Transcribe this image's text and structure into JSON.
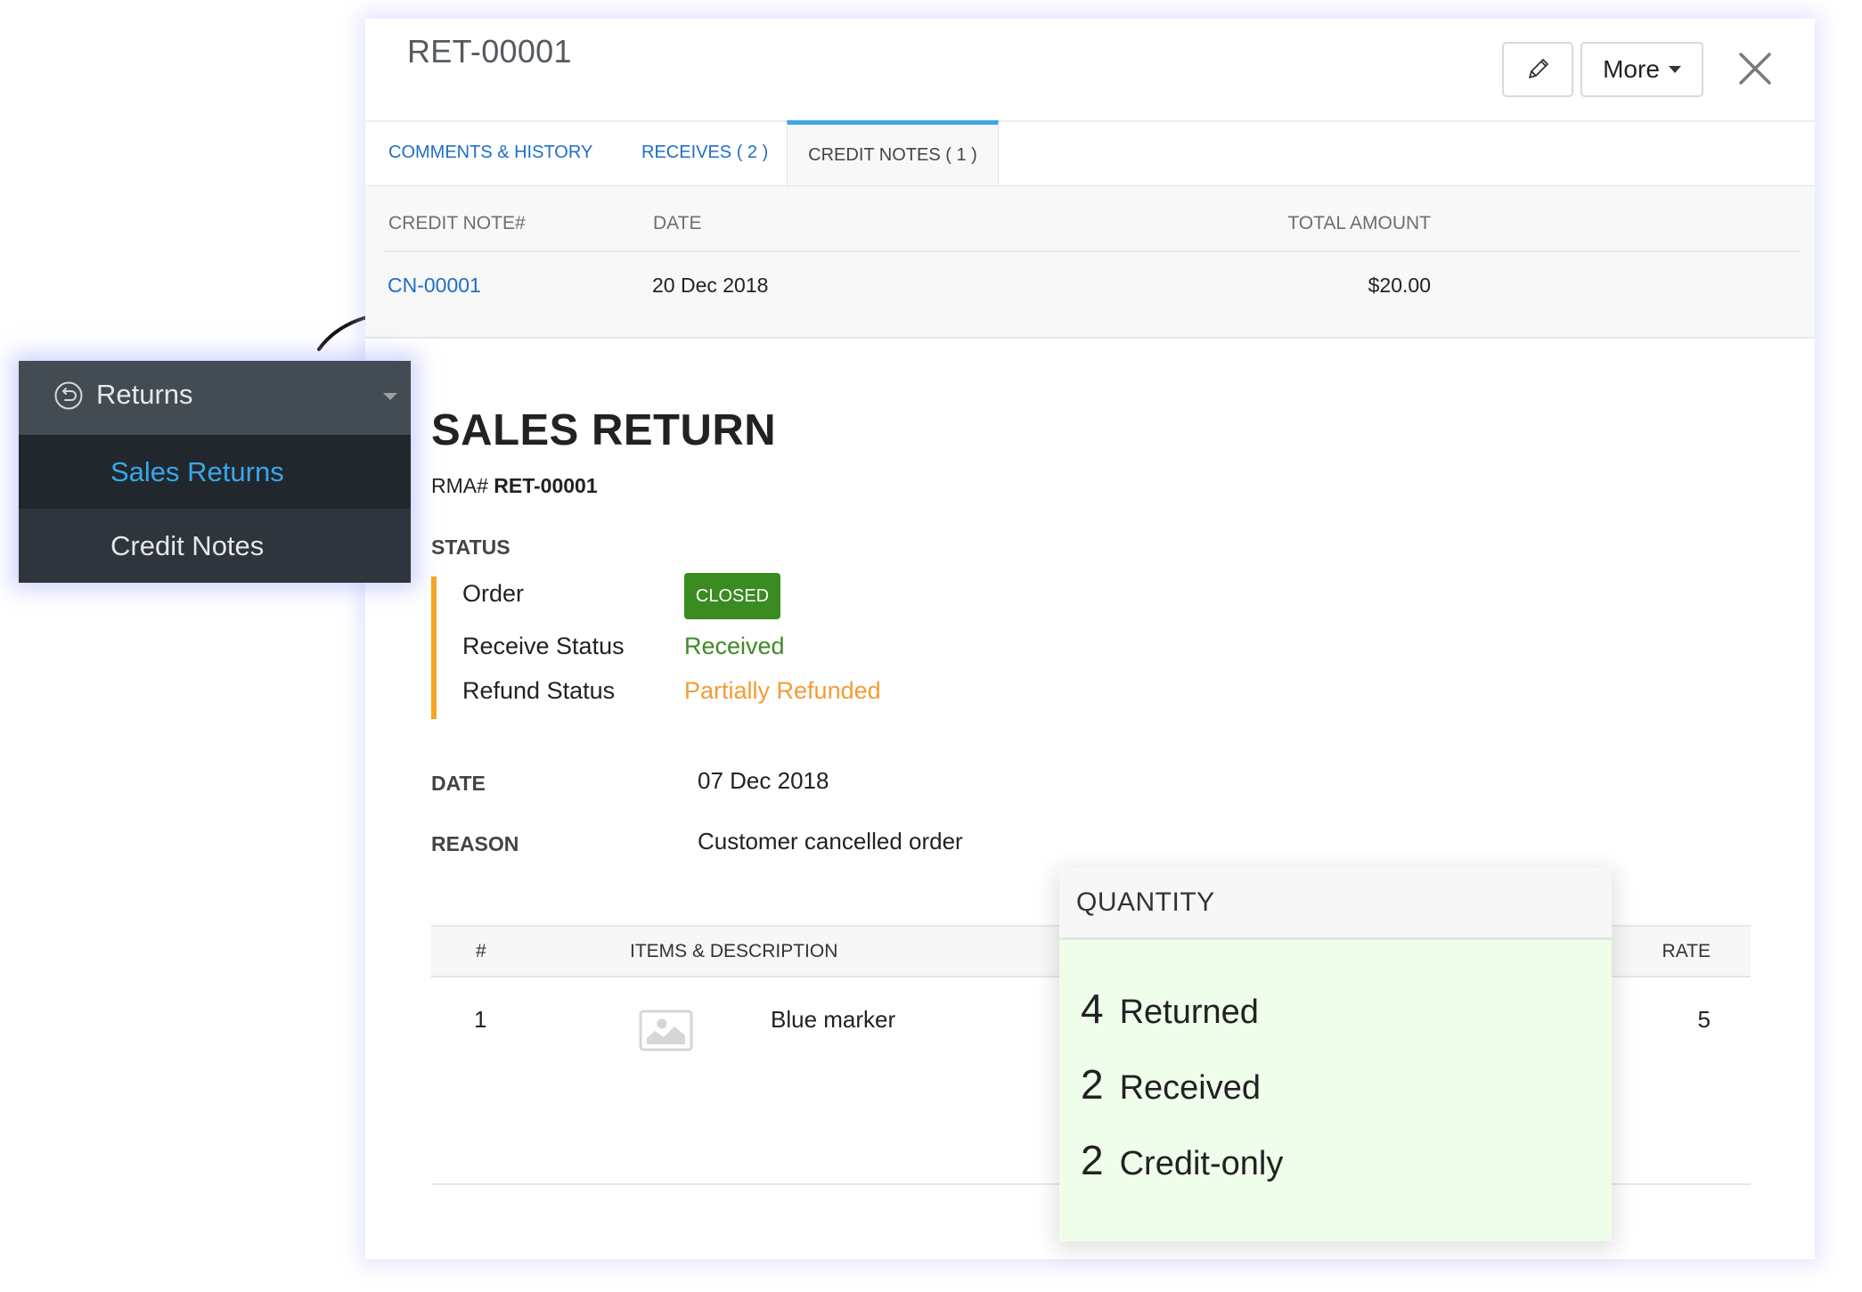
{
  "header": {
    "title": "RET-00001",
    "edit_icon": "pencil-icon",
    "more_label": "More",
    "close_icon": "close-icon"
  },
  "tabs": [
    {
      "label": "COMMENTS & HISTORY",
      "active": false
    },
    {
      "label": "RECEIVES ( 2 )",
      "active": false
    },
    {
      "label": "CREDIT NOTES ( 1 )",
      "active": true
    }
  ],
  "credit_notes": {
    "columns": [
      "CREDIT NOTE#",
      "DATE",
      "TOTAL AMOUNT"
    ],
    "rows": [
      {
        "number": "CN-00001",
        "date": "20 Dec 2018",
        "amount": "$20.00"
      }
    ]
  },
  "sidebar": {
    "group_label": "Returns",
    "group_icon": "return-circle-icon",
    "items": [
      {
        "label": "Sales Returns",
        "active": true
      },
      {
        "label": "Credit Notes",
        "active": false
      }
    ]
  },
  "document": {
    "title": "SALES RETURN",
    "rma_prefix": "RMA#",
    "rma_number": "RET-00001",
    "status_heading": "STATUS",
    "statuses": [
      {
        "key": "Order",
        "value": "CLOSED"
      },
      {
        "key": "Receive Status",
        "value": "Received"
      },
      {
        "key": "Refund Status",
        "value": "Partially Refunded"
      }
    ],
    "fields": [
      {
        "key": "DATE",
        "value": "07 Dec 2018"
      },
      {
        "key": "REASON",
        "value": "Customer cancelled order"
      }
    ]
  },
  "items_table": {
    "columns": [
      "#",
      "ITEMS & DESCRIPTION",
      "RATE"
    ],
    "rows": [
      {
        "index": "1",
        "name": "Blue marker",
        "rate": "5"
      }
    ]
  },
  "quantity_popup": {
    "title": "QUANTITY",
    "rows": [
      {
        "count": "4",
        "label": "Returned"
      },
      {
        "count": "2",
        "label": "Received"
      },
      {
        "count": "2",
        "label": "Credit-only"
      }
    ]
  },
  "colors": {
    "accent_blue": "#3ea6e6",
    "link_blue": "#1e6fc7",
    "closed_green": "#3a8b22",
    "received_green": "#3d8b25",
    "refund_orange": "#f39c34",
    "status_bar_orange": "#f5a623",
    "quantity_bg": "#effdeb"
  }
}
